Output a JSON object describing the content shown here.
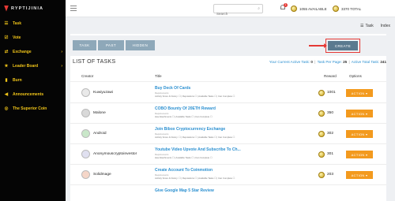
{
  "brand": {
    "logo_text": "RYPTIJINIA"
  },
  "sidebar": {
    "items": [
      {
        "label": "Task",
        "icon": "list-icon",
        "glyph": "☰",
        "chevron": ""
      },
      {
        "label": "Vote",
        "icon": "check-square-icon",
        "glyph": "☑",
        "chevron": ""
      },
      {
        "label": "Exchange",
        "icon": "exchange-icon",
        "glyph": "⇄",
        "chevron": "›"
      },
      {
        "label": "Leader Board",
        "icon": "star-icon",
        "glyph": "★",
        "chevron": "›"
      },
      {
        "label": "Burn",
        "icon": "fire-icon",
        "glyph": "▮",
        "chevron": ""
      },
      {
        "label": "Announcements",
        "icon": "bullhorn-icon",
        "glyph": "◀",
        "chevron": ""
      },
      {
        "label": "The Superior Coin",
        "icon": "coin-icon",
        "glyph": "◎",
        "chevron": ""
      }
    ]
  },
  "topbar": {
    "search_placeholder": "Search",
    "notification_count": "1",
    "available": "1055 AVAILABLE",
    "total": "3370 TOTAL"
  },
  "subnav": {
    "task": "Task",
    "index": "Index"
  },
  "tabs": {
    "task": "TASK",
    "past": "PAST",
    "hidden": "HIDDEN"
  },
  "create_label": "CREATE",
  "list": {
    "title": "LIST OF TASKS",
    "active_label": "Your Current Active Task:",
    "active_value": "0",
    "per_page_label": "Task Per Page:",
    "per_page_value": "25",
    "total_label": "Active Total Task:",
    "total_value": "241"
  },
  "columns": {
    "creator": "Creator",
    "title": "Title",
    "reward": "Reward",
    "options": "Options"
  },
  "rows": [
    {
      "creator": "Kuwiyuzawi",
      "title": "Buy Deck Of Cards",
      "sub": "Requirements",
      "detail": "Activity Score & history: ☐ | Reputations ☐ | Available Tasks ☐ | Can Complete ☐",
      "reward": "1001",
      "action": "ACTION ▾"
    },
    {
      "creator": "Malone",
      "title": "COBO Bounty Of 20ETH Reward",
      "sub": "Requirements",
      "detail": "Has Attachments ☐ | Available Tasks ☐ | Can Complete ☐",
      "reward": "350",
      "action": "ACTION ▾"
    },
    {
      "creator": "Android",
      "title": "Join Bibox Cryptocurrency Exchange",
      "sub": "Requirements",
      "detail": "Activity Score & history: ☐ | Reputations ☐ | Available Tasks ☐ | Can Complete ☐",
      "reward": "302",
      "action": "ACTION ▾"
    },
    {
      "creator": "Anonymouscryptoinvestor",
      "title": "Youtube Video Upvote And Subscribe To Ch...",
      "sub": "Requirements",
      "detail": "Has Attachments ☐ | Available Tasks ☐ | Can Complete ☐",
      "reward": "301",
      "action": "ACTION ▾"
    },
    {
      "creator": "Solidmage",
      "title": "Create Account To Coinmotion",
      "sub": "Requirements",
      "detail": "Activity Score & history: ☐ | Reputations ☐ | Available Tasks ☐ | Can Complete ☐",
      "reward": "203",
      "action": "ACTION ▾"
    },
    {
      "creator": "",
      "title": "Give Google Map 5 Star Review",
      "sub": "",
      "detail": "",
      "reward": "",
      "action": ""
    }
  ]
}
